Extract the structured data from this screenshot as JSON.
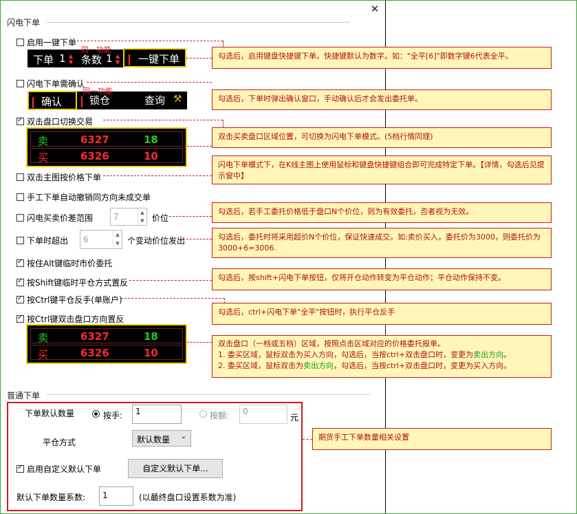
{
  "dialog": {
    "close_glyph": "✕"
  },
  "flash": {
    "section_title": "闪电下单",
    "enable_one_key": "启用一键下单",
    "bar1": {
      "order_label": "下单",
      "order_count": "1",
      "sets_label": "条数",
      "sets_count": "1",
      "one_key_btn": "一键下单"
    },
    "same_function_1": "同一功能",
    "need_confirm": "闪电下单需确认",
    "bar2": {
      "confirm": "确认",
      "lock": "锁仓",
      "query": "查询"
    },
    "same_function_2": "同一功能",
    "dbl_click_switch": "双击盘口切换交易",
    "quote1": {
      "sell_label": "卖",
      "sell_price": "6327",
      "sell_qty": "18",
      "buy_label": "买",
      "buy_price": "6326",
      "buy_qty": "10"
    },
    "dbl_click_chart": "双击主图按价格下单",
    "manual_cancel": "手工下单自动撤销同方向未成交单",
    "spread_label": "闪电买卖价差范围",
    "spread_value": "7",
    "spread_unit": "价位",
    "overshoot_label": "下单时超出",
    "overshoot_value": "6",
    "overshoot_unit": "个变动价位发出",
    "alt_market": "按住Alt键临时市价委托",
    "shift_close": "按Shift键临时平仓方式置反",
    "ctrl_reverse": "按Ctrl键平仓反手(单账户)",
    "ctrl_dbl_reverse": "按Ctrl键双击盘口方向置反",
    "quote2": {
      "sell_label": "卖",
      "sell_price": "6327",
      "sell_qty": "18",
      "buy_label": "买",
      "buy_price": "6326",
      "buy_qty": "10"
    }
  },
  "normal": {
    "section_title": "普通下单",
    "default_qty_label": "下单默认数量",
    "by_hand_label": "按手:",
    "by_hand_value": "1",
    "by_amount_label": "按额:",
    "by_amount_value": "0",
    "amount_unit": "元",
    "close_mode_label": "平仓方式",
    "close_mode_value": "默认数量",
    "custom_enable": "启用自定义默认下单",
    "custom_btn": "自定义默认下单...",
    "coef_label": "默认下单数量系数:",
    "coef_value": "1",
    "coef_note": "(以最终盘口设置系数为准)"
  },
  "annotations": {
    "a1": "勾选后，启用键盘快捷键下单。快捷键默认为数字。如：\"全平[6]\"即数字键6代表全平。",
    "a2": "勾选后，下单时弹出确认窗口，手动确认后才会发出委托单。",
    "a3": "双击买卖盘口区域位置，可切换为闪电下单模式。(5档行情同理)",
    "a4": "闪电下单模式下，在K线主图上使用鼠标和键盘快捷键组合即可完成特定下单。【详情，勾选后见提示窗中】",
    "a5": "勾选后，若手工委托价格低于盘口N个价位，则为有效委托，否者视为无效。",
    "a6": "勾选后，委托时将采用超价N个价位，保证快速成交。如:卖价买入，委托价为3000，则委托价为3000+6=3006.",
    "a7": "勾选后，按shift+闪电下单按钮，仅将开仓动作转变为平仓动作；平仓动作保持不变。",
    "a8": "勾选后，ctrl+闪电下单\"全平\"按钮时，执行平仓反手",
    "a9_line1": "双击盘口（一档或五档）区域，按照点击区域对应的价格委托报单。",
    "a9_line2_pre": "1. 委买区域，鼠标双击为买入方向，勾选后，当按ctrl+双击盘口时，变更为",
    "a9_line2_green": "卖出方向",
    "a9_line2_post": "。",
    "a9_line3_pre": "2. 委买区域，鼠标双击为",
    "a9_line3_green": "卖出方向",
    "a9_line3_post": "，勾选后，当按ctrl+双击盘口时，变更为买入方向。",
    "a10": "期货手工下单数量相关设置"
  },
  "colors": {
    "annotation_bg": "#fff6b8",
    "annotation_border": "#d01818",
    "accent_yellow": "#f0d000",
    "sell_green": "#22cc22",
    "price_red": "#ff2a2a"
  }
}
